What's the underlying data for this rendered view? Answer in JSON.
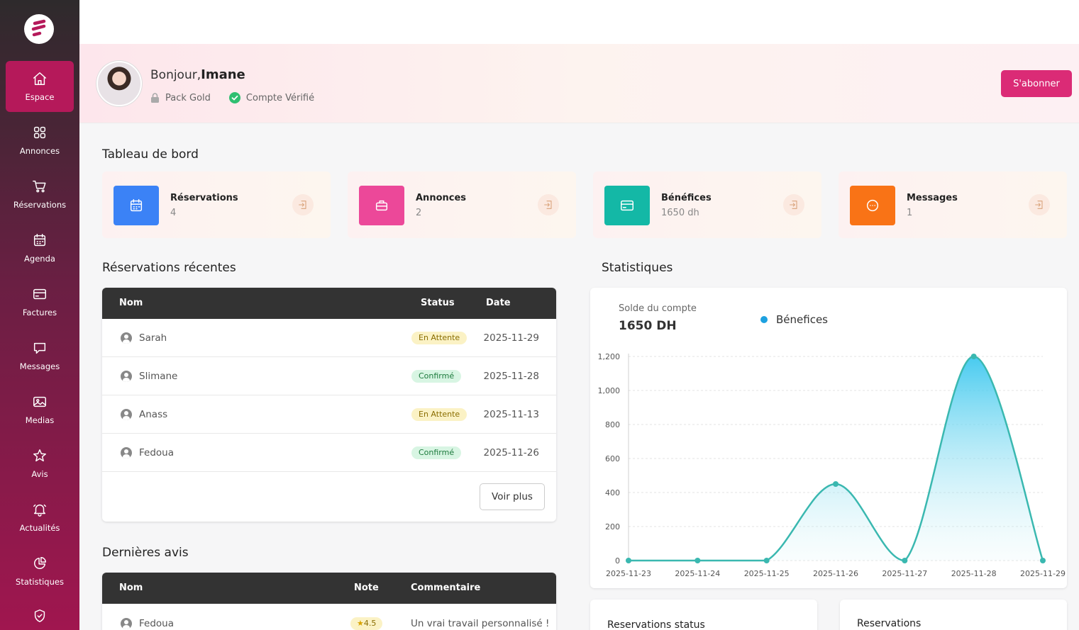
{
  "sidebar": {
    "items": [
      {
        "label": "Espace",
        "icon": "home-icon"
      },
      {
        "label": "Annonces",
        "icon": "grid-icon"
      },
      {
        "label": "Réservations",
        "icon": "cart-icon"
      },
      {
        "label": "Agenda",
        "icon": "calendar-icon"
      },
      {
        "label": "Factures",
        "icon": "card-icon"
      },
      {
        "label": "Messages",
        "icon": "message-icon"
      },
      {
        "label": "Medias",
        "icon": "image-icon"
      },
      {
        "label": "Avis",
        "icon": "star-icon"
      },
      {
        "label": "Actualités",
        "icon": "bell-icon"
      },
      {
        "label": "Statistiques",
        "icon": "pie-chart-icon"
      },
      {
        "label": "",
        "icon": "shield-check-icon"
      }
    ]
  },
  "profile": {
    "greeting": "Bonjour,",
    "name": "Imane",
    "pack": "Pack Gold",
    "verified": "Compte Vérifié",
    "subscribe_label": "S'abonner"
  },
  "dashboard": {
    "title": "Tableau de bord",
    "cards": [
      {
        "title": "Réservations",
        "value": "4",
        "color": "#3b82f6",
        "icon": "calendar-icon"
      },
      {
        "title": "Annonces",
        "value": "2",
        "color": "#ec4899",
        "icon": "briefcase-icon"
      },
      {
        "title": "Bénéfices",
        "value": "1650 dh",
        "color": "#14b8a6",
        "icon": "card-icon"
      },
      {
        "title": "Messages",
        "value": "1",
        "color": "#f97316",
        "icon": "message-icon"
      }
    ]
  },
  "recent": {
    "title": "Réservations récentes",
    "headers": {
      "name": "Nom",
      "status": "Status",
      "date": "Date"
    },
    "rows": [
      {
        "name": "Sarah",
        "status": "En Attente",
        "kind": "wait",
        "date": "2025-11-29"
      },
      {
        "name": "Slimane",
        "status": "Confirmé",
        "kind": "ok",
        "date": "2025-11-28"
      },
      {
        "name": "Anass",
        "status": "En Attente",
        "kind": "wait",
        "date": "2025-11-13"
      },
      {
        "name": "Fedoua",
        "status": "Confirmé",
        "kind": "ok",
        "date": "2025-11-26"
      }
    ],
    "more_label": "Voir plus"
  },
  "reviews": {
    "title": "Dernières avis",
    "headers": {
      "name": "Nom",
      "note": "Note",
      "comment": "Commentaire"
    },
    "rows": [
      {
        "name": "Fedoua",
        "note": "4.5",
        "comment": "Un vrai travail personnalisé !"
      }
    ]
  },
  "stats": {
    "title": "Statistiques",
    "balance_label": "Solde du compte",
    "balance_value": "1650 DH"
  },
  "chart_data": {
    "type": "area",
    "x": [
      "2025-11-23",
      "2025-11-24",
      "2025-11-25",
      "2025-11-26",
      "2025-11-27",
      "2025-11-28",
      "2025-11-29"
    ],
    "series": [
      {
        "name": "Bénefices",
        "values": [
          0,
          0,
          0,
          450,
          0,
          1200,
          0
        ],
        "color": "#3ab8b0"
      }
    ],
    "yticks": [
      "0",
      "200",
      "400",
      "600",
      "800",
      "1,000",
      "1,200"
    ],
    "ylim": [
      0,
      1200
    ],
    "grid": true,
    "legend_position": "top"
  },
  "bottom_cards": {
    "left": "Reservations status",
    "right": "Reservations"
  }
}
